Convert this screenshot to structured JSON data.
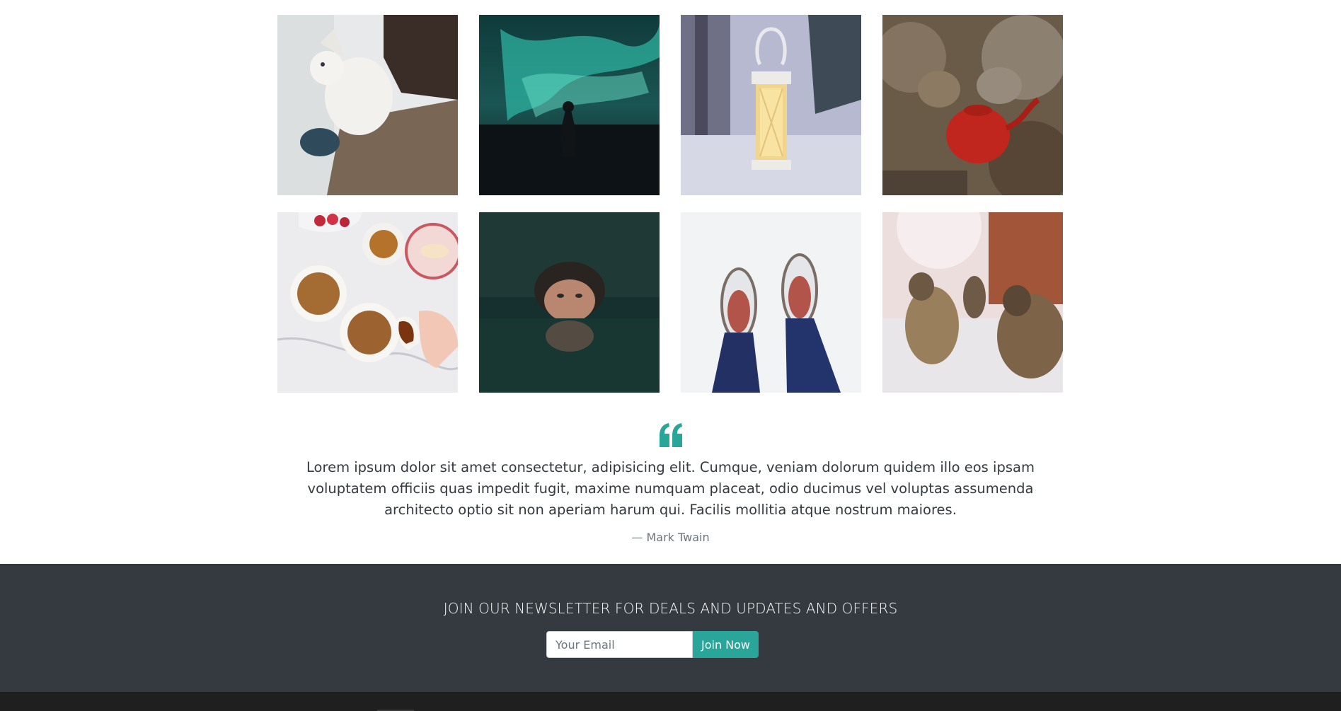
{
  "gallery": {
    "images": [
      {
        "name": "husky-puppy-photo"
      },
      {
        "name": "northern-lights-photo"
      },
      {
        "name": "snow-lantern-photo"
      },
      {
        "name": "campfire-kettles-photo"
      },
      {
        "name": "breakfast-bowls-photo"
      },
      {
        "name": "woman-in-water-photo"
      },
      {
        "name": "snowshoes-photo"
      },
      {
        "name": "sled-dogs-photo"
      }
    ]
  },
  "quote": {
    "icon": "quote-left-icon",
    "accent": "#29a59a",
    "text": "Lorem ipsum dolor sit amet consectetur, adipisicing elit. Cumque, veniam dolorum quidem illo eos ipsam voluptatem officiis quas impedit fugit, maxime numquam placeat, odio ducimus vel voluptas assumenda architecto optio sit non aperiam harum qui. Facilis mollitia atque nostrum maiores.",
    "author": "— Mark Twain"
  },
  "newsletter": {
    "title": "JOIN OUR NEWSLETTER FOR DEALS AND UPDATES AND OFFERS",
    "email_placeholder": "Your Email",
    "button_label": "Join Now",
    "background": "#343a40",
    "button_color": "#29a59a"
  }
}
